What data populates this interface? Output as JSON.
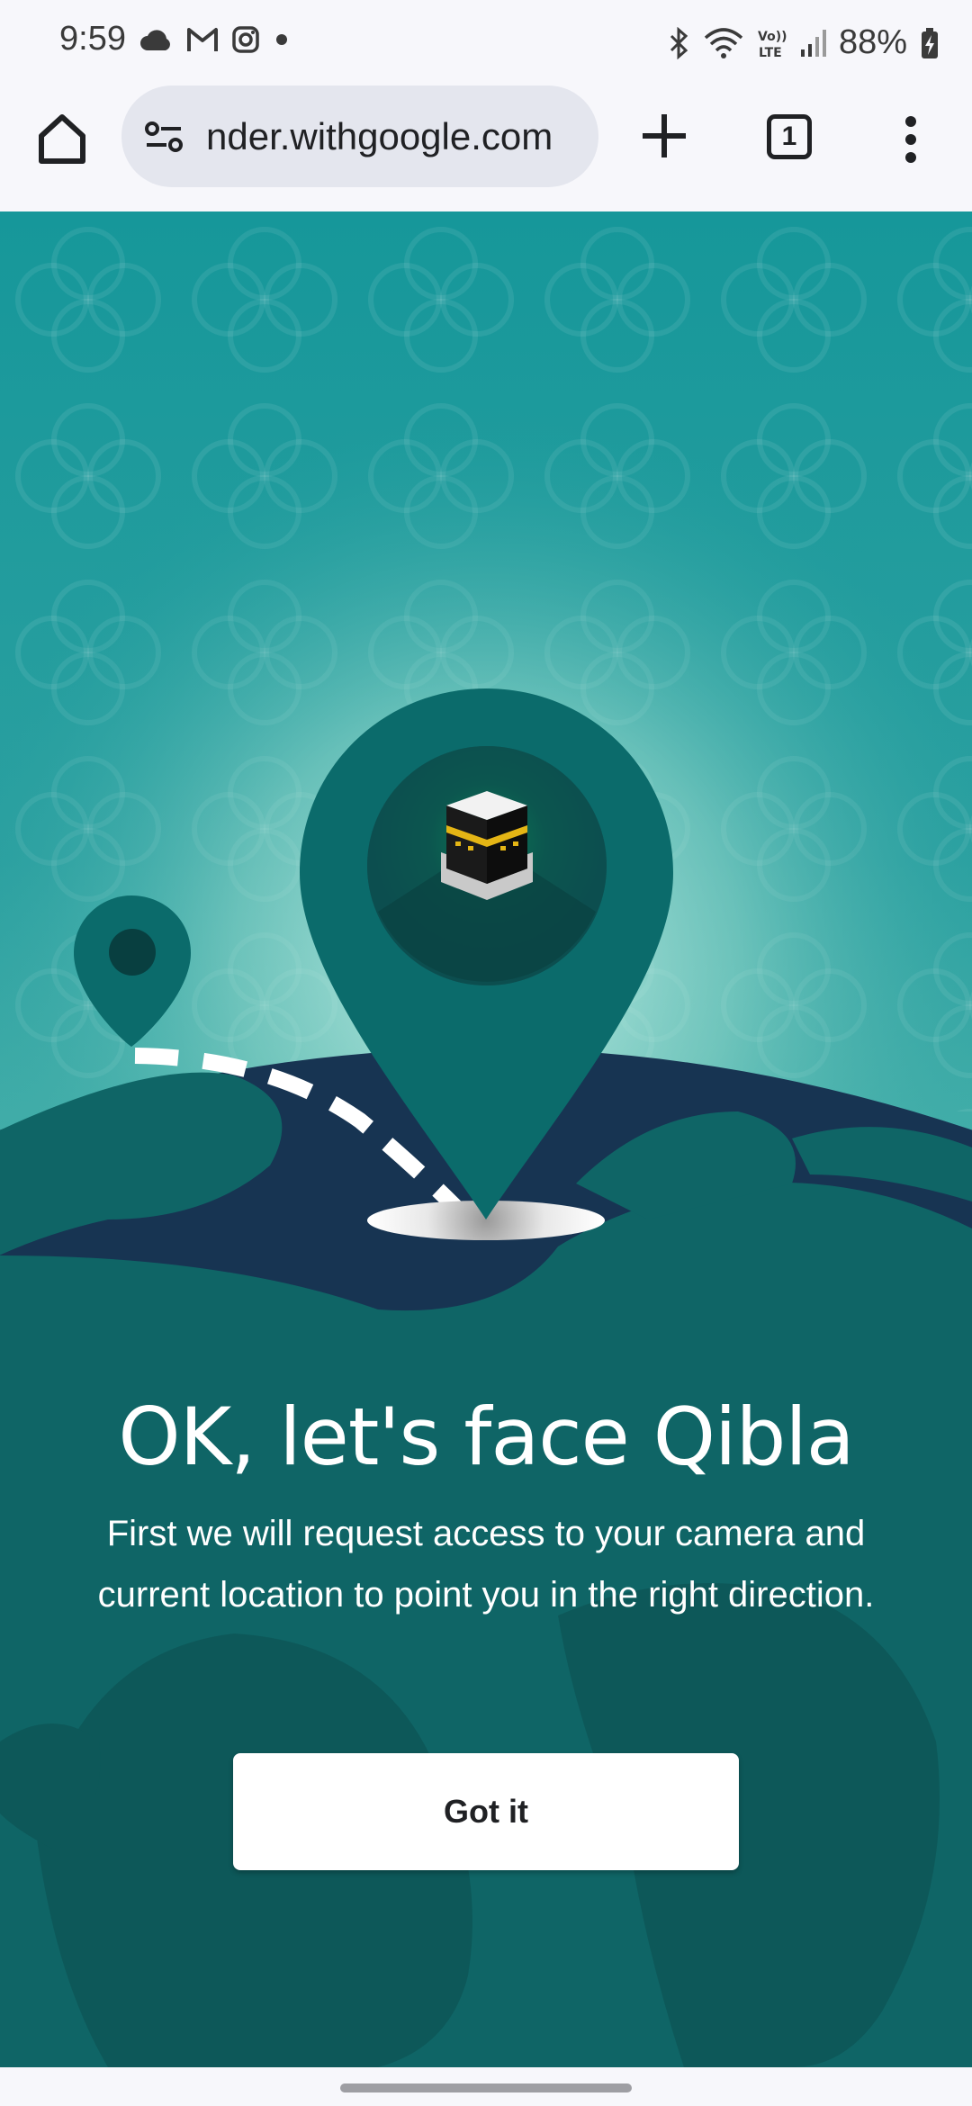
{
  "status_bar": {
    "time": "9:59",
    "battery": "88%",
    "left_icons": [
      "cloud-icon",
      "gmail-icon",
      "instagram-icon",
      "dot-icon"
    ],
    "right_icons": [
      "bluetooth-icon",
      "wifi-icon",
      "volte-icon",
      "signal-icon",
      "battery-charging-icon"
    ]
  },
  "browser": {
    "url": "nder.withgoogle.com",
    "tab_count": "1",
    "icons": [
      "home-icon",
      "site-settings-icon",
      "new-tab-icon",
      "tabs-icon",
      "more-vert-icon"
    ]
  },
  "main": {
    "headline": "OK, let's face Qibla",
    "description": "First we will request access to your camera and current location to point you in the right direction.",
    "button_label": "Got it"
  },
  "colors": {
    "background_teal": "#16979a",
    "pin_teal": "#0b6b6b",
    "globe_dark": "#173452",
    "land_teal": "#0f6566",
    "button_bg": "#ffffff"
  }
}
